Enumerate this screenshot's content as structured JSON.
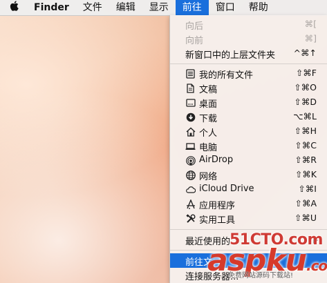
{
  "menubar": {
    "apple": "",
    "app": "Finder",
    "items": [
      "文件",
      "编辑",
      "显示",
      "前往",
      "窗口",
      "帮助"
    ]
  },
  "go_menu": {
    "items": [
      {
        "label": "向后",
        "shortcut": "⌘[",
        "icon": "",
        "disabled": true
      },
      {
        "label": "向前",
        "shortcut": "⌘]",
        "icon": "",
        "disabled": true
      },
      {
        "label": "新窗口中的上层文件夹",
        "shortcut": "^⌘↑",
        "icon": ""
      },
      {
        "label": "我的所有文件",
        "shortcut": "⇧⌘F",
        "icon": "all-files-icon"
      },
      {
        "label": "文稿",
        "shortcut": "⇧⌘O",
        "icon": "documents-icon"
      },
      {
        "label": "桌面",
        "shortcut": "⇧⌘D",
        "icon": "desktop-icon"
      },
      {
        "label": "下载",
        "shortcut": "⌥⌘L",
        "icon": "downloads-icon"
      },
      {
        "label": "个人",
        "shortcut": "⇧⌘H",
        "icon": "home-icon"
      },
      {
        "label": "电脑",
        "shortcut": "⇧⌘C",
        "icon": "computer-icon"
      },
      {
        "label": "AirDrop",
        "shortcut": "⇧⌘R",
        "icon": "airdrop-icon"
      },
      {
        "label": "网络",
        "shortcut": "⇧⌘K",
        "icon": "network-icon"
      },
      {
        "label": "iCloud Drive",
        "shortcut": "⇧⌘I",
        "icon": "icloud-icon"
      },
      {
        "label": "应用程序",
        "shortcut": "⇧⌘A",
        "icon": "applications-icon"
      },
      {
        "label": "实用工具",
        "shortcut": "⇧⌘U",
        "icon": "utilities-icon"
      },
      {
        "label": "最近使用的",
        "shortcut": "",
        "icon": ""
      },
      {
        "label": "前往文",
        "shortcut": "",
        "icon": "",
        "highlight": true
      },
      {
        "label": "连接服务器...",
        "shortcut": "",
        "icon": ""
      }
    ]
  },
  "watermark": {
    "site": "51CTO.com",
    "brand": "aspku",
    "brand_suffix": ".com",
    "tagline": "免费网站源码下载站!"
  }
}
